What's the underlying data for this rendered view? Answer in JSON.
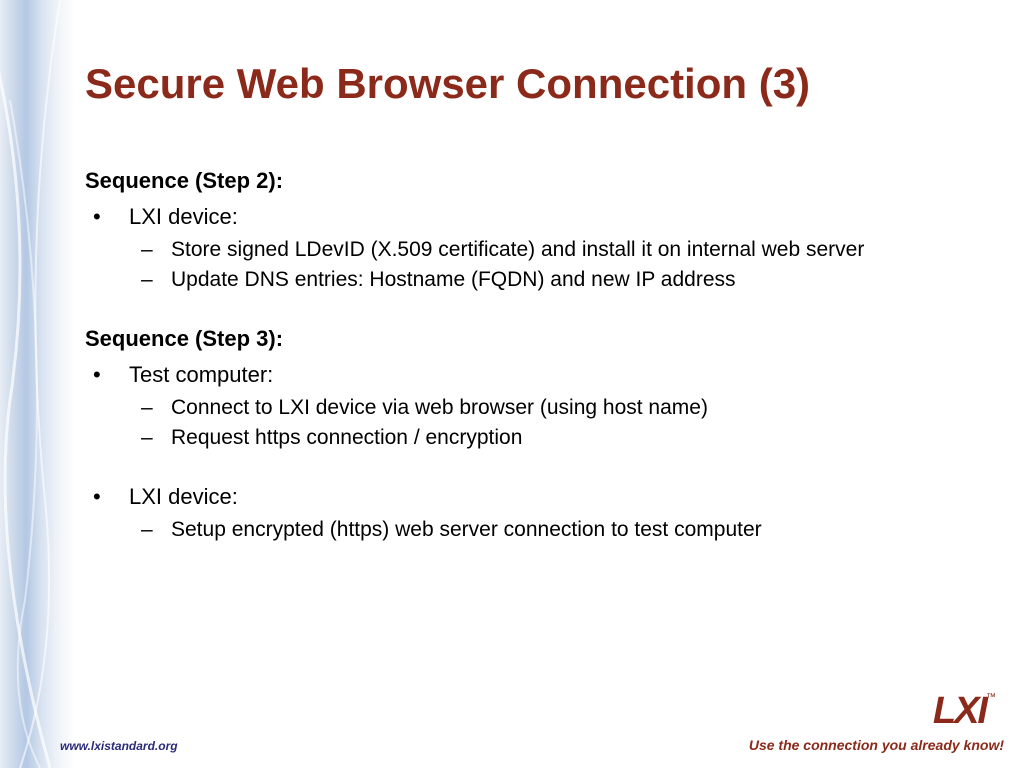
{
  "title": "Secure Web Browser Connection (3)",
  "sections": [
    {
      "heading": "Sequence (Step 2):",
      "items": [
        {
          "text": "LXI device:",
          "subs": [
            "Store signed LDevID (X.509 certificate) and install it on internal web server",
            "Update DNS entries: Hostname (FQDN) and new IP address"
          ]
        }
      ]
    },
    {
      "heading": "Sequence (Step 3):",
      "items": [
        {
          "text": "Test computer:",
          "subs": [
            "Connect to LXI device via web browser (using host name)",
            "Request https connection / encryption"
          ]
        },
        {
          "text": "LXI device:",
          "subs": [
            "Setup encrypted (https) web server connection to test computer"
          ]
        }
      ]
    }
  ],
  "footer": {
    "url": "www.lxistandard.org",
    "tagline": "Use the connection you already know!"
  },
  "logo": {
    "text": "LXI",
    "tm": "™"
  }
}
